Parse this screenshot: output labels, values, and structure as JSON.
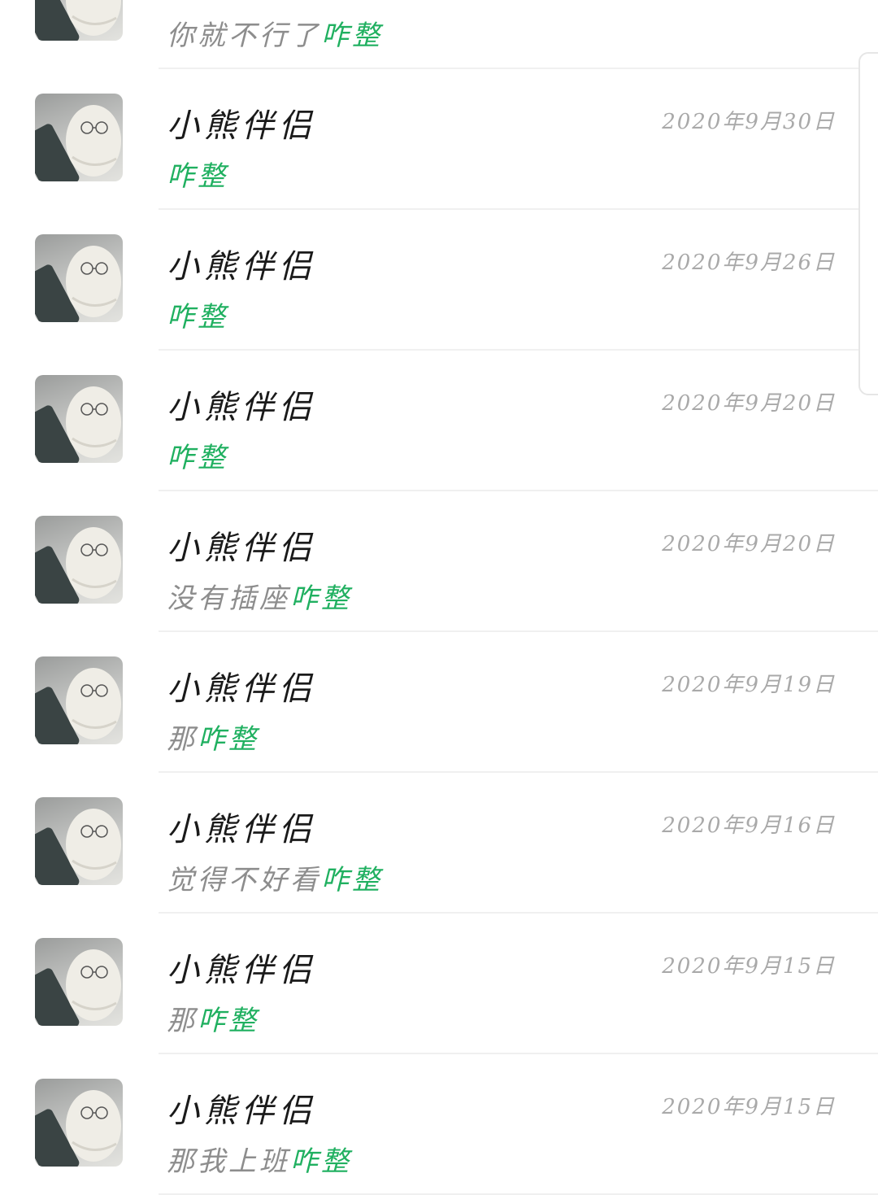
{
  "accent_color": "#20b060",
  "contact_name": "小熊伴侣",
  "chats": [
    {
      "date": "",
      "text": "你就不行了",
      "highlight": "咋整",
      "show_name": false
    },
    {
      "date": "2020年9月30日",
      "text": "",
      "highlight": "咋整",
      "show_name": true
    },
    {
      "date": "2020年9月26日",
      "text": "",
      "highlight": "咋整",
      "show_name": true
    },
    {
      "date": "2020年9月20日",
      "text": "",
      "highlight": "咋整",
      "show_name": true
    },
    {
      "date": "2020年9月20日",
      "text": "没有插座",
      "highlight": "咋整",
      "show_name": true
    },
    {
      "date": "2020年9月19日",
      "text": "那",
      "highlight": "咋整",
      "show_name": true
    },
    {
      "date": "2020年9月16日",
      "text": "觉得不好看",
      "highlight": "咋整",
      "show_name": true
    },
    {
      "date": "2020年9月15日",
      "text": "那",
      "highlight": "咋整",
      "show_name": true
    },
    {
      "date": "2020年9月15日",
      "text": "那我上班",
      "highlight": "咋整",
      "show_name": true
    }
  ]
}
